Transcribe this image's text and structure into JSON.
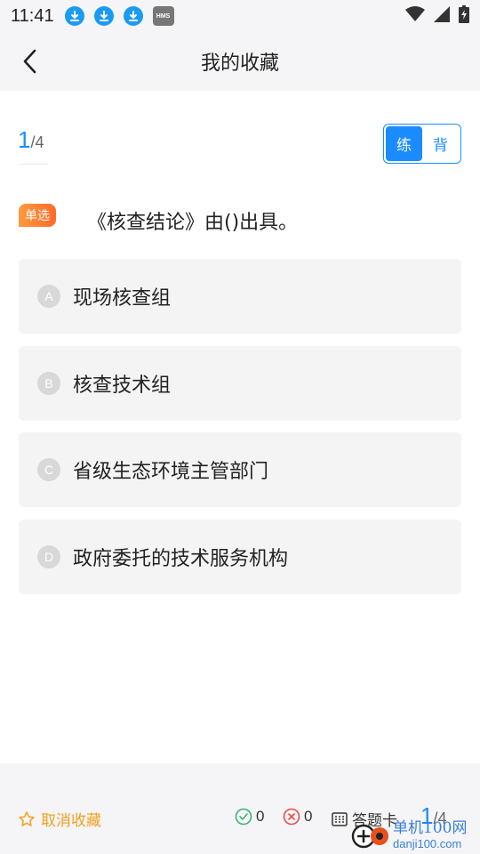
{
  "status_bar": {
    "time": "11:41",
    "hms_label": "HMS",
    "icons": [
      "download-icon",
      "download-icon",
      "download-icon",
      "hms-icon",
      "wifi-icon",
      "signal-icon",
      "battery-charging-icon"
    ]
  },
  "header": {
    "title": "我的收藏"
  },
  "progress": {
    "current": "1",
    "total": "/4"
  },
  "mode_toggle": {
    "practice": "练",
    "recite": "背"
  },
  "question": {
    "type_badge": "单选",
    "text": "《核查结论》由()出具。",
    "options": [
      {
        "letter": "A",
        "text": "现场核查组"
      },
      {
        "letter": "B",
        "text": "核查技术组"
      },
      {
        "letter": "C",
        "text": "省级生态环境主管部门"
      },
      {
        "letter": "D",
        "text": "政府委托的技术服务机构"
      }
    ]
  },
  "bottom_bar": {
    "unfavorite_label": "取消收藏",
    "correct_count": "0",
    "wrong_count": "0",
    "answer_card_label": "答题卡",
    "progress_current": "1",
    "progress_total": "/4"
  },
  "watermark": {
    "cn": "单机100网",
    "en": "danji100.com"
  },
  "colors": {
    "accent": "#1a8cff",
    "badge": "#ff7a30",
    "favorite": "#f0a020",
    "correct": "#3cb371",
    "wrong": "#e84c4c"
  }
}
